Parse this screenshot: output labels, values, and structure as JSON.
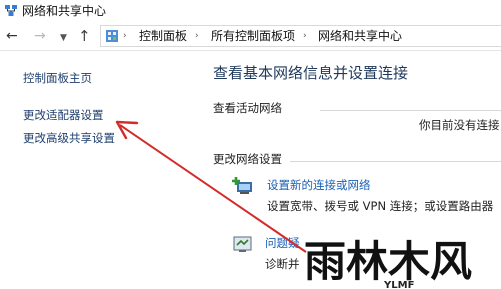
{
  "window": {
    "title": "网络和共享中心"
  },
  "address_bar": {
    "breadcrumbs": [
      "控制面板",
      "所有控制面板项",
      "网络和共享中心"
    ]
  },
  "sidebar": {
    "items": [
      {
        "label": "控制面板主页"
      },
      {
        "label": "更改适配器设置"
      },
      {
        "label": "更改高级共享设置"
      }
    ]
  },
  "main": {
    "heading": "查看基本网络信息并设置连接",
    "active_networks": {
      "label": "查看活动网络",
      "status": "你目前没有连接"
    },
    "change_settings": {
      "label": "更改网络设置",
      "items": [
        {
          "title": "设置新的连接或网络",
          "description": "设置宽带、拨号或 VPN 连接；或设置路由器",
          "icon": "new-connection-icon"
        },
        {
          "title": "问题疑",
          "description": "诊断并",
          "icon": "troubleshoot-icon"
        }
      ]
    }
  },
  "watermark": {
    "text": "雨林木风",
    "sub": "YLMF"
  },
  "colors": {
    "annotation_arrow": "#d42a2a",
    "link": "#1a5fb4",
    "heading": "#1e395b"
  }
}
